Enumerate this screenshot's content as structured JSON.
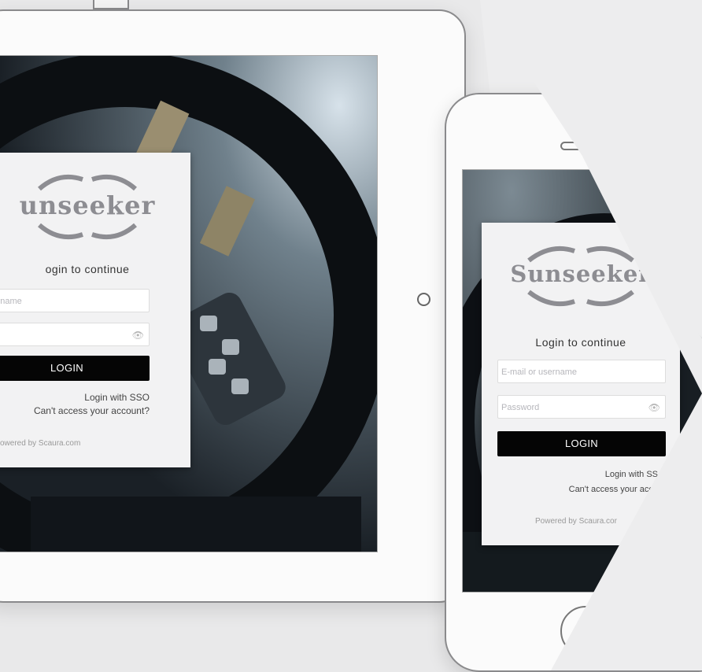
{
  "colors": {
    "background": "#e9e9ea",
    "device_frame": "#8a8a8c",
    "card": "#f2f2f3",
    "button": "#050505",
    "logo": "#8d8d92"
  },
  "brand": {
    "logo_text": "Sunseeker",
    "tablet_logo_text": "unseeker"
  },
  "tablet": {
    "heading": "ogin to continue",
    "username_placeholder": "sername",
    "password_placeholder": "",
    "password_icon": "eye-icon",
    "login_label": "LOGIN",
    "sso_label": "Login with SSO",
    "access_label": "Can't access your account?",
    "powered_label": "owered by Scaura.com"
  },
  "phone": {
    "heading": "Login to continue",
    "username_placeholder": "E-mail or username",
    "password_placeholder": "Password",
    "password_icon": "eye-icon",
    "login_label": "LOGIN",
    "sso_label": "Login with SS",
    "access_label": "Can't access your acco",
    "powered_label": "Powered by Scaura.cor"
  }
}
